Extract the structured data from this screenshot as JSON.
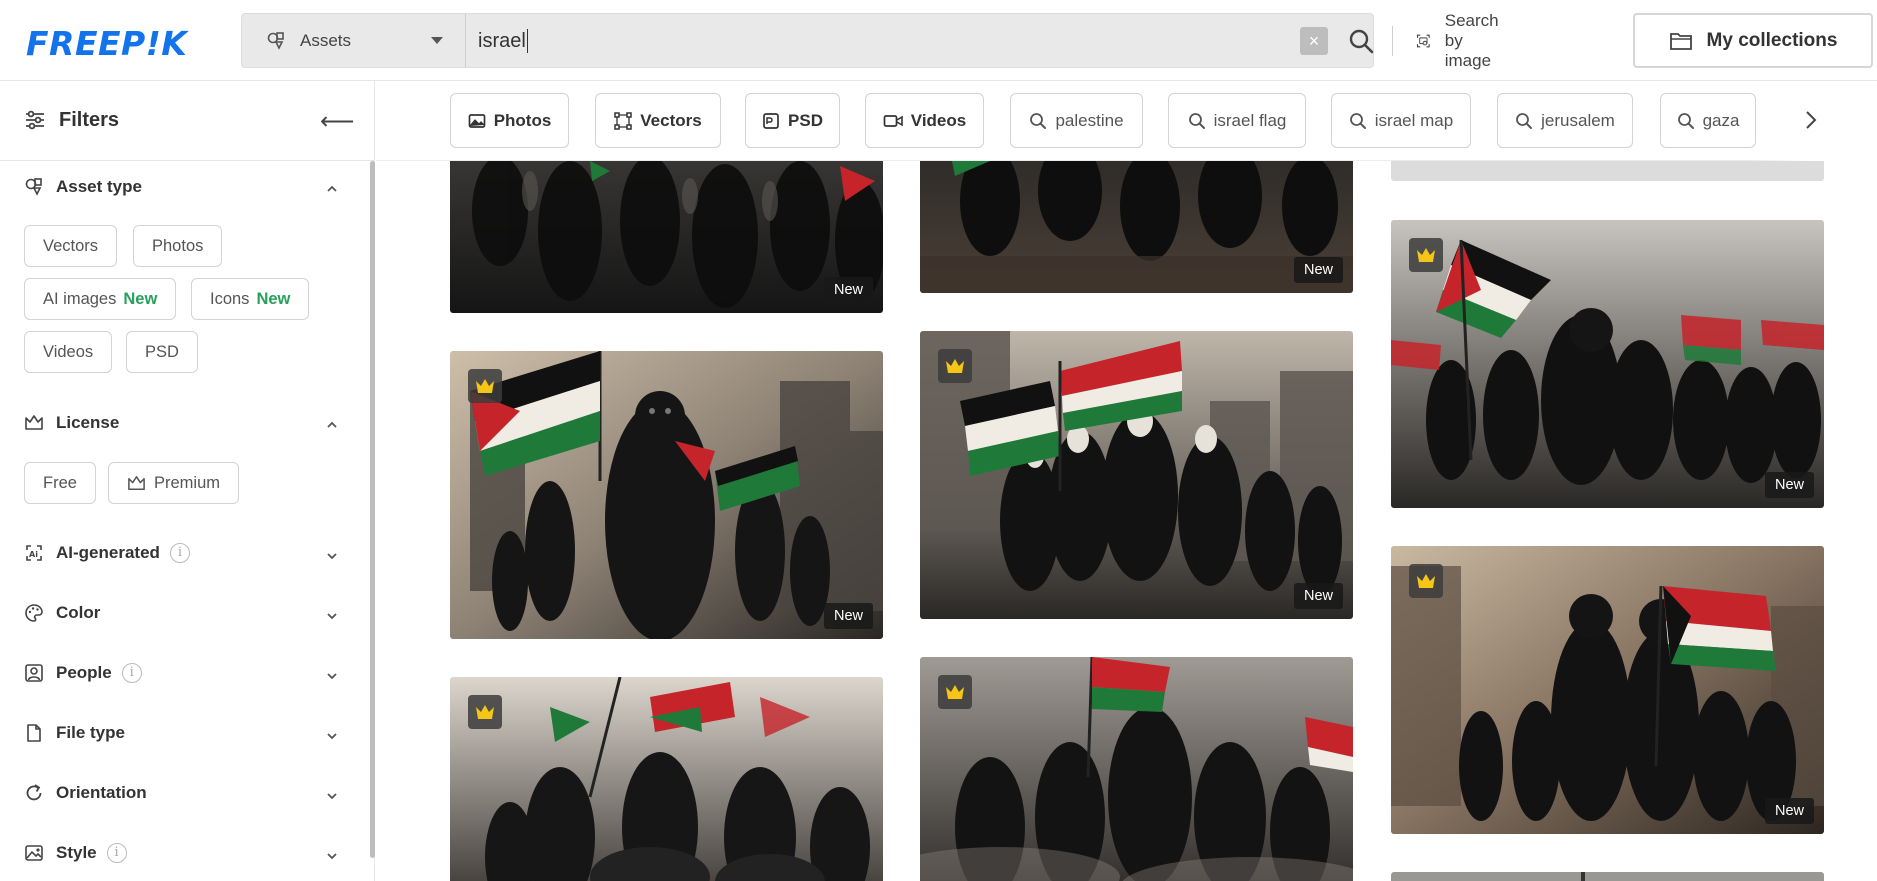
{
  "header": {
    "logo": "FREEP!K",
    "asset_dropdown": "Assets",
    "search_value": "israel",
    "clear_symbol": "×",
    "search_by_image": "Search by image",
    "my_collections": "My collections"
  },
  "sidebar": {
    "title": "Filters",
    "collapse_symbol": "⟵",
    "asset_type": {
      "title": "Asset type",
      "chips": [
        "Vectors",
        "Photos",
        "AI images",
        "Icons",
        "Videos",
        "PSD"
      ],
      "new_label": "New"
    },
    "license": {
      "title": "License",
      "chips": [
        "Free",
        "Premium"
      ]
    },
    "sections": [
      "AI-generated",
      "Color",
      "People",
      "File type",
      "Orientation",
      "Style"
    ],
    "info_symbol": "i"
  },
  "tags": [
    "Photos",
    "Vectors",
    "PSD",
    "Videos",
    "palestine",
    "israel flag",
    "israel map",
    "jerusalem",
    "gaza"
  ],
  "grid": {
    "new_label": "New",
    "colors": {
      "crown": "#f5c518",
      "dark": "#1b1b1b",
      "smoke": "#9a9088",
      "flag_red": "#c5242a",
      "flag_green": "#1f7a3a"
    }
  }
}
